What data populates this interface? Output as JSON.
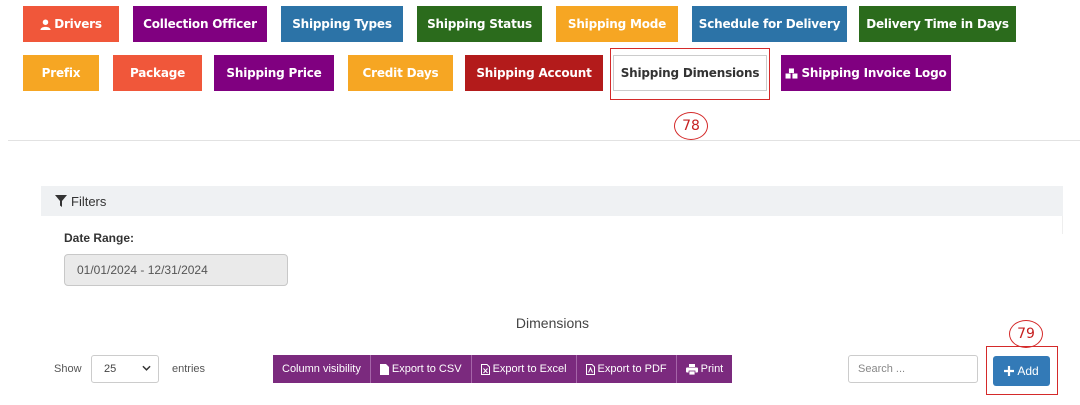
{
  "tabs": [
    {
      "label": "Drivers",
      "color": "#f0573a",
      "icon": "user-icon"
    },
    {
      "label": "Collection Officer",
      "color": "#800080"
    },
    {
      "label": "Shipping Types",
      "color": "#2c73a7"
    },
    {
      "label": "Shipping Status",
      "color": "#2b6b1c"
    },
    {
      "label": "Shipping Mode",
      "color": "#f6a623"
    },
    {
      "label": "Schedule for Delivery",
      "color": "#2c73a7"
    },
    {
      "label": "Delivery Time in Days",
      "color": "#2b6b1c"
    },
    {
      "label": "Prefix",
      "color": "#f6a623"
    },
    {
      "label": "Package",
      "color": "#f0573a"
    },
    {
      "label": "Shipping Price",
      "color": "#800080"
    },
    {
      "label": "Credit Days",
      "color": "#f6a623"
    },
    {
      "label": "Shipping Account",
      "color": "#b31b1b"
    },
    {
      "label": "Shipping Dimensions",
      "active": true
    },
    {
      "label": "Shipping Invoice Logo",
      "color": "#800080",
      "icon": "cubes-icon"
    }
  ],
  "annotations": {
    "a78": "78",
    "a79": "79"
  },
  "filters": {
    "title": "Filters",
    "date_label": "Date Range:",
    "date_value": "01/01/2024 - 12/31/2024"
  },
  "table": {
    "title": "Dimensions",
    "show_label": "Show",
    "entries_value": "25",
    "entries_label": "entries",
    "buttons": [
      {
        "label": "Column visibility"
      },
      {
        "label": "Export to CSV",
        "icon": "file-icon"
      },
      {
        "label": "Export to Excel",
        "icon": "file-excel-icon"
      },
      {
        "label": "Export to PDF",
        "icon": "file-pdf-icon"
      },
      {
        "label": "Print",
        "icon": "print-icon"
      }
    ],
    "search_placeholder": "Search ...",
    "add_label": "Add"
  }
}
